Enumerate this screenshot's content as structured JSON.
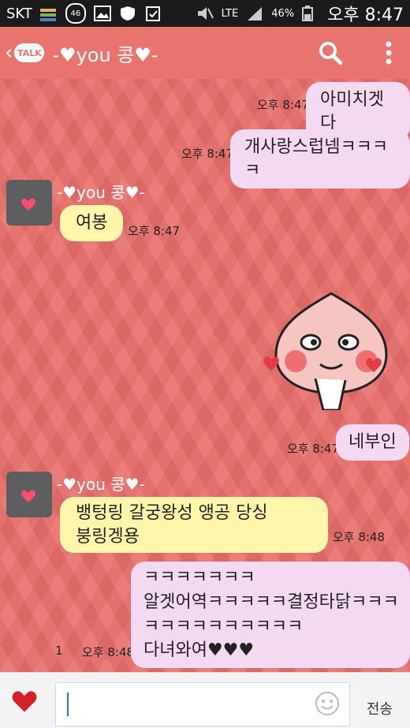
{
  "status": {
    "carrier": "SKT",
    "badge": "46",
    "net": "LTE",
    "battery": "46%",
    "time": "오후 8:47"
  },
  "header": {
    "talk_badge": "TALK",
    "title": "-♥you 콩♥-"
  },
  "messages": {
    "m1": {
      "text": "아미치겟다",
      "time": "오후 8:47"
    },
    "m2": {
      "text": "개사랑스럽넴ㅋㅋㅋㅋ",
      "time": "오후 8:47"
    },
    "m3": {
      "sender": "-♥you 콩♥-",
      "text": "여봉",
      "time": "오후 8:47"
    },
    "m4": {
      "text": "네부인",
      "time": "오후 8:47"
    },
    "m5": {
      "sender": "-♥you 콩♥-",
      "line1": "뱅텅링 갈궁왕성 앵공 당싱",
      "line2": "붕링겡용",
      "time": "오후 8:48"
    },
    "m6": {
      "line1": "ㅋㅋㅋㅋㅋㅋㅋ",
      "line2": "알겟어역ㅋㅋㅋㅋㅋ결정타닭ㅋㅋㅋ",
      "line3": "ㅋㅋㅋㅋㅋㅋㅋㅋㅋㅋ",
      "line4": "다녀와여♥♥♥",
      "unread": "1",
      "time": "오후 8:48"
    }
  },
  "input": {
    "send_label": "전송"
  },
  "colors": {
    "background": "#e86d6a",
    "sent": "#f4d9f3",
    "received": "#fff6ac"
  },
  "icons": [
    "back-icon",
    "search-icon",
    "more-icon",
    "emoji-icon",
    "heart-icon"
  ]
}
